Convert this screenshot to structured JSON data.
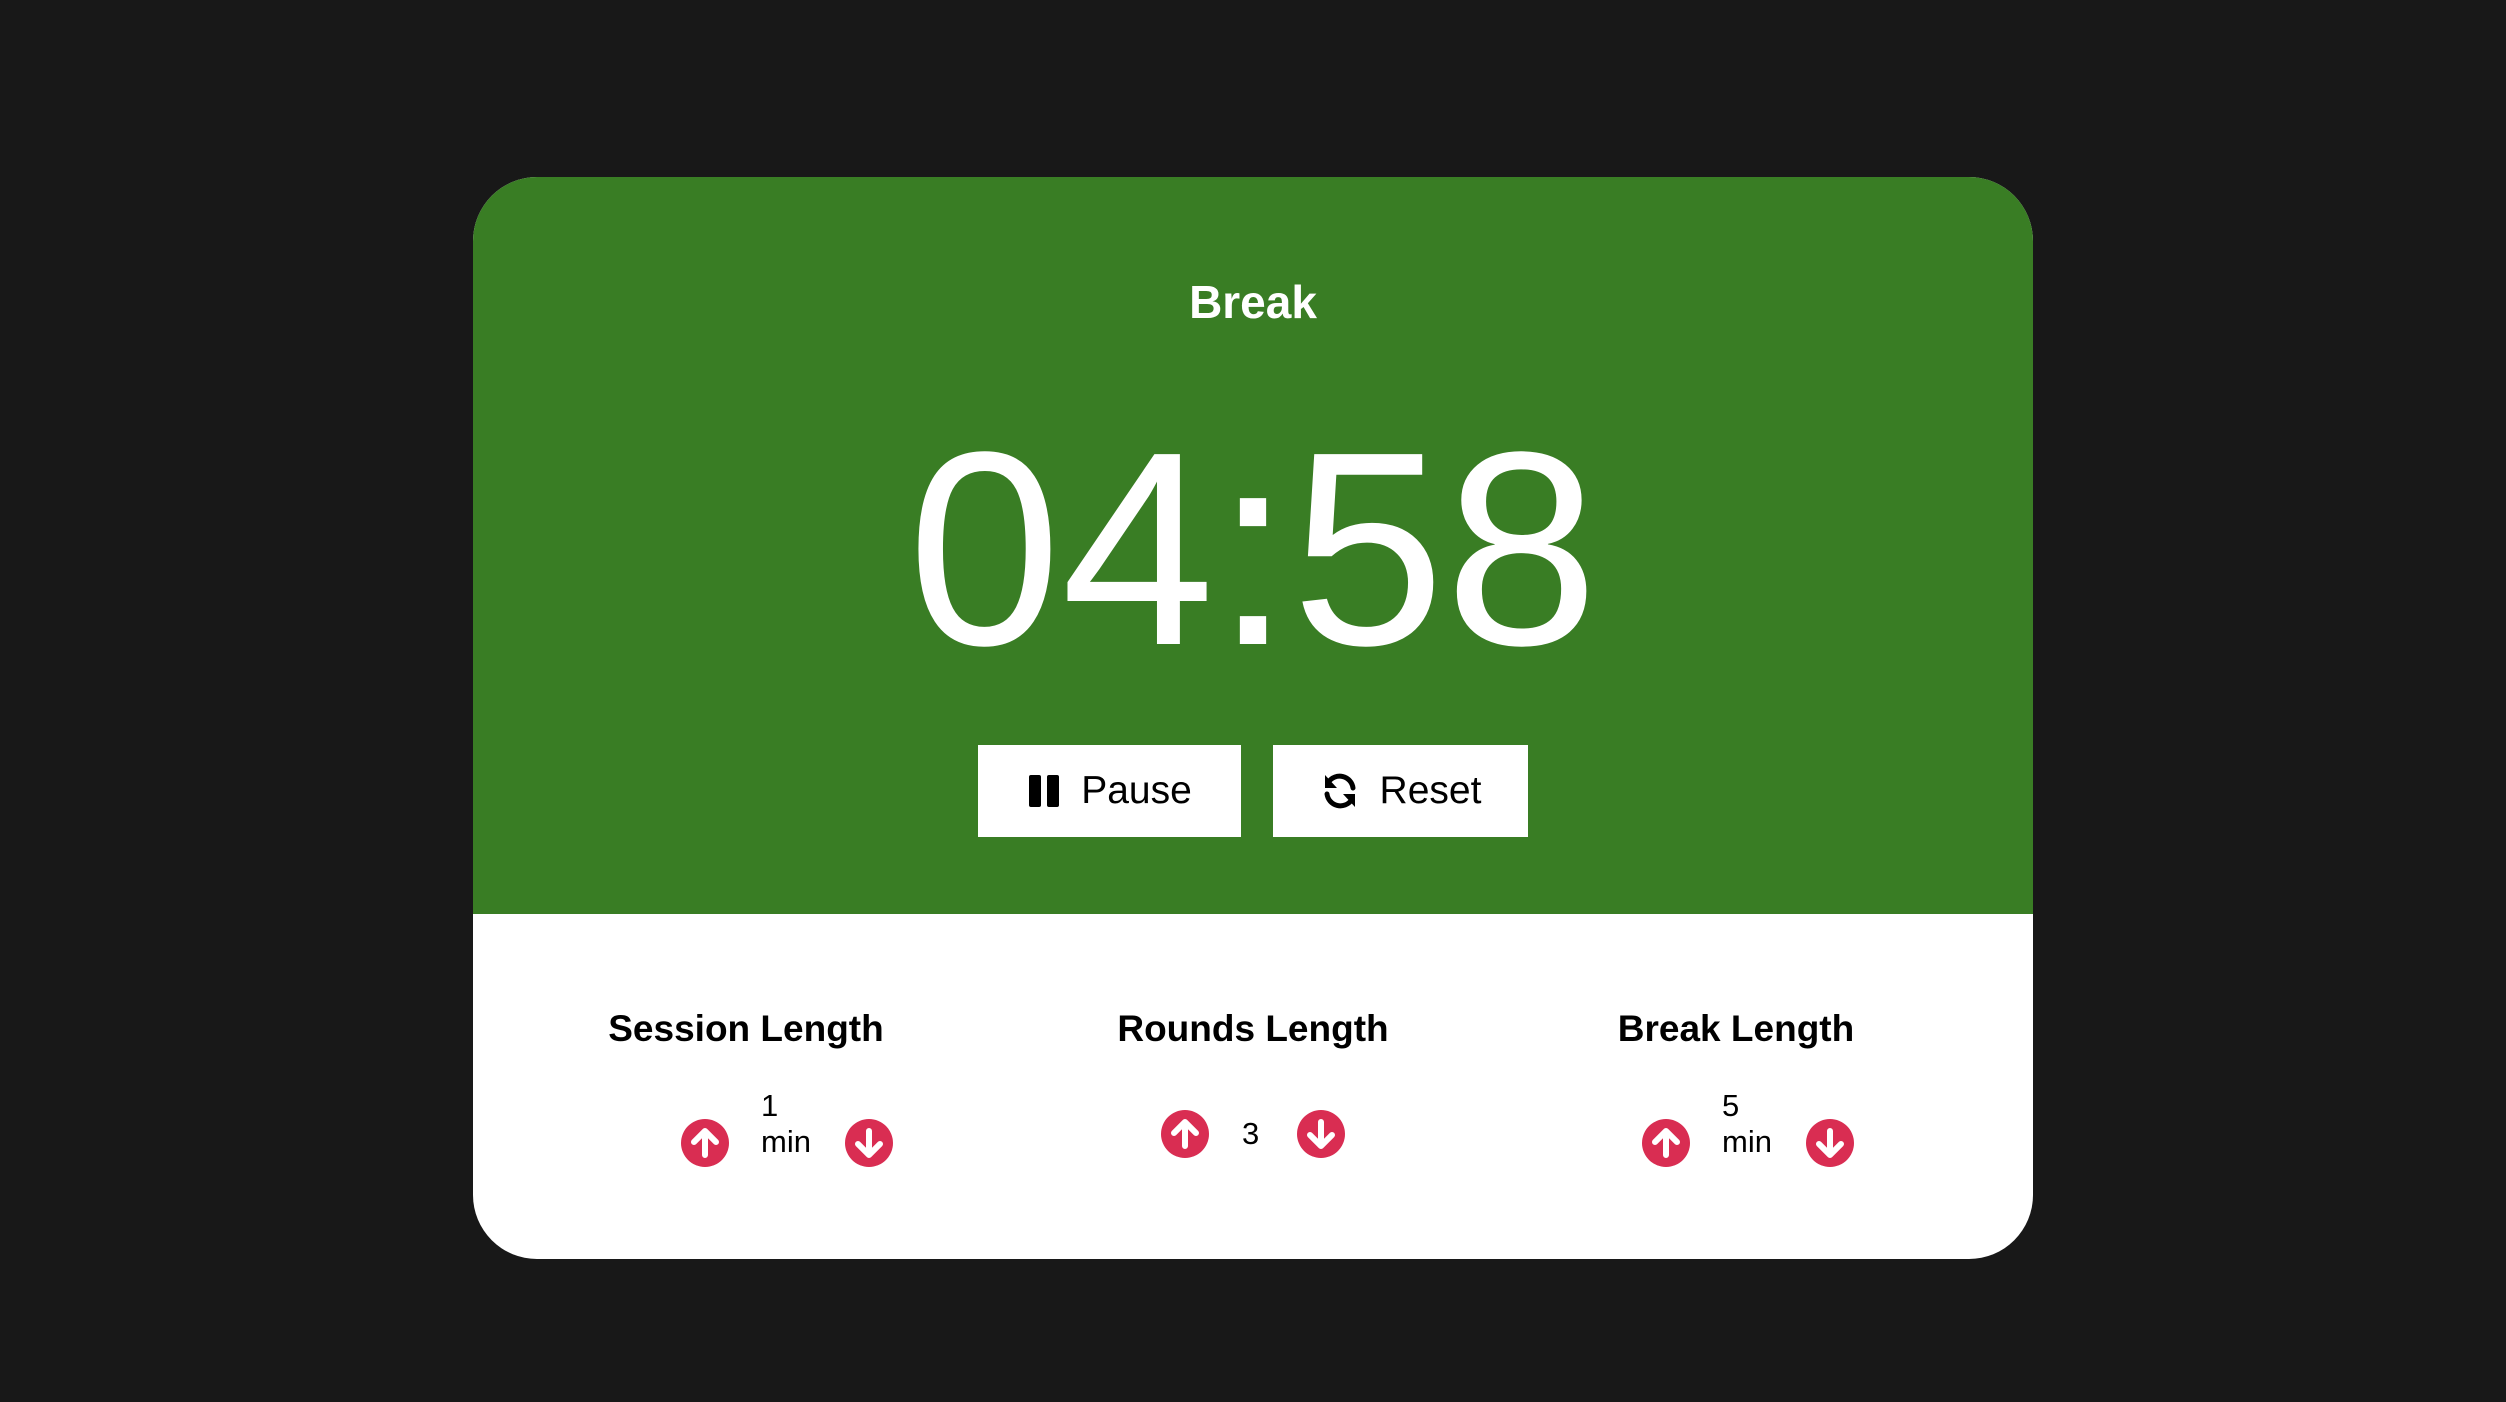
{
  "colors": {
    "page_background": "#181818",
    "timer_panel": "#397d24",
    "settings_panel": "#ffffff",
    "control_accent": "#d92d52"
  },
  "timer": {
    "mode_label": "Break",
    "time_display": "04:58"
  },
  "controls": {
    "pause_label": "Pause",
    "pause_icon": "pause-icon",
    "reset_label": "Reset",
    "reset_icon": "refresh-icon"
  },
  "settings": {
    "session": {
      "title": "Session Length",
      "value": "1",
      "unit": "min",
      "up_icon": "arrow-up-circle-icon",
      "down_icon": "arrow-down-circle-icon"
    },
    "rounds": {
      "title": "Rounds Length",
      "value": "3",
      "up_icon": "arrow-up-circle-icon",
      "down_icon": "arrow-down-circle-icon"
    },
    "break": {
      "title": "Break Length",
      "value": "5",
      "unit": "min",
      "up_icon": "arrow-up-circle-icon",
      "down_icon": "arrow-down-circle-icon"
    }
  }
}
